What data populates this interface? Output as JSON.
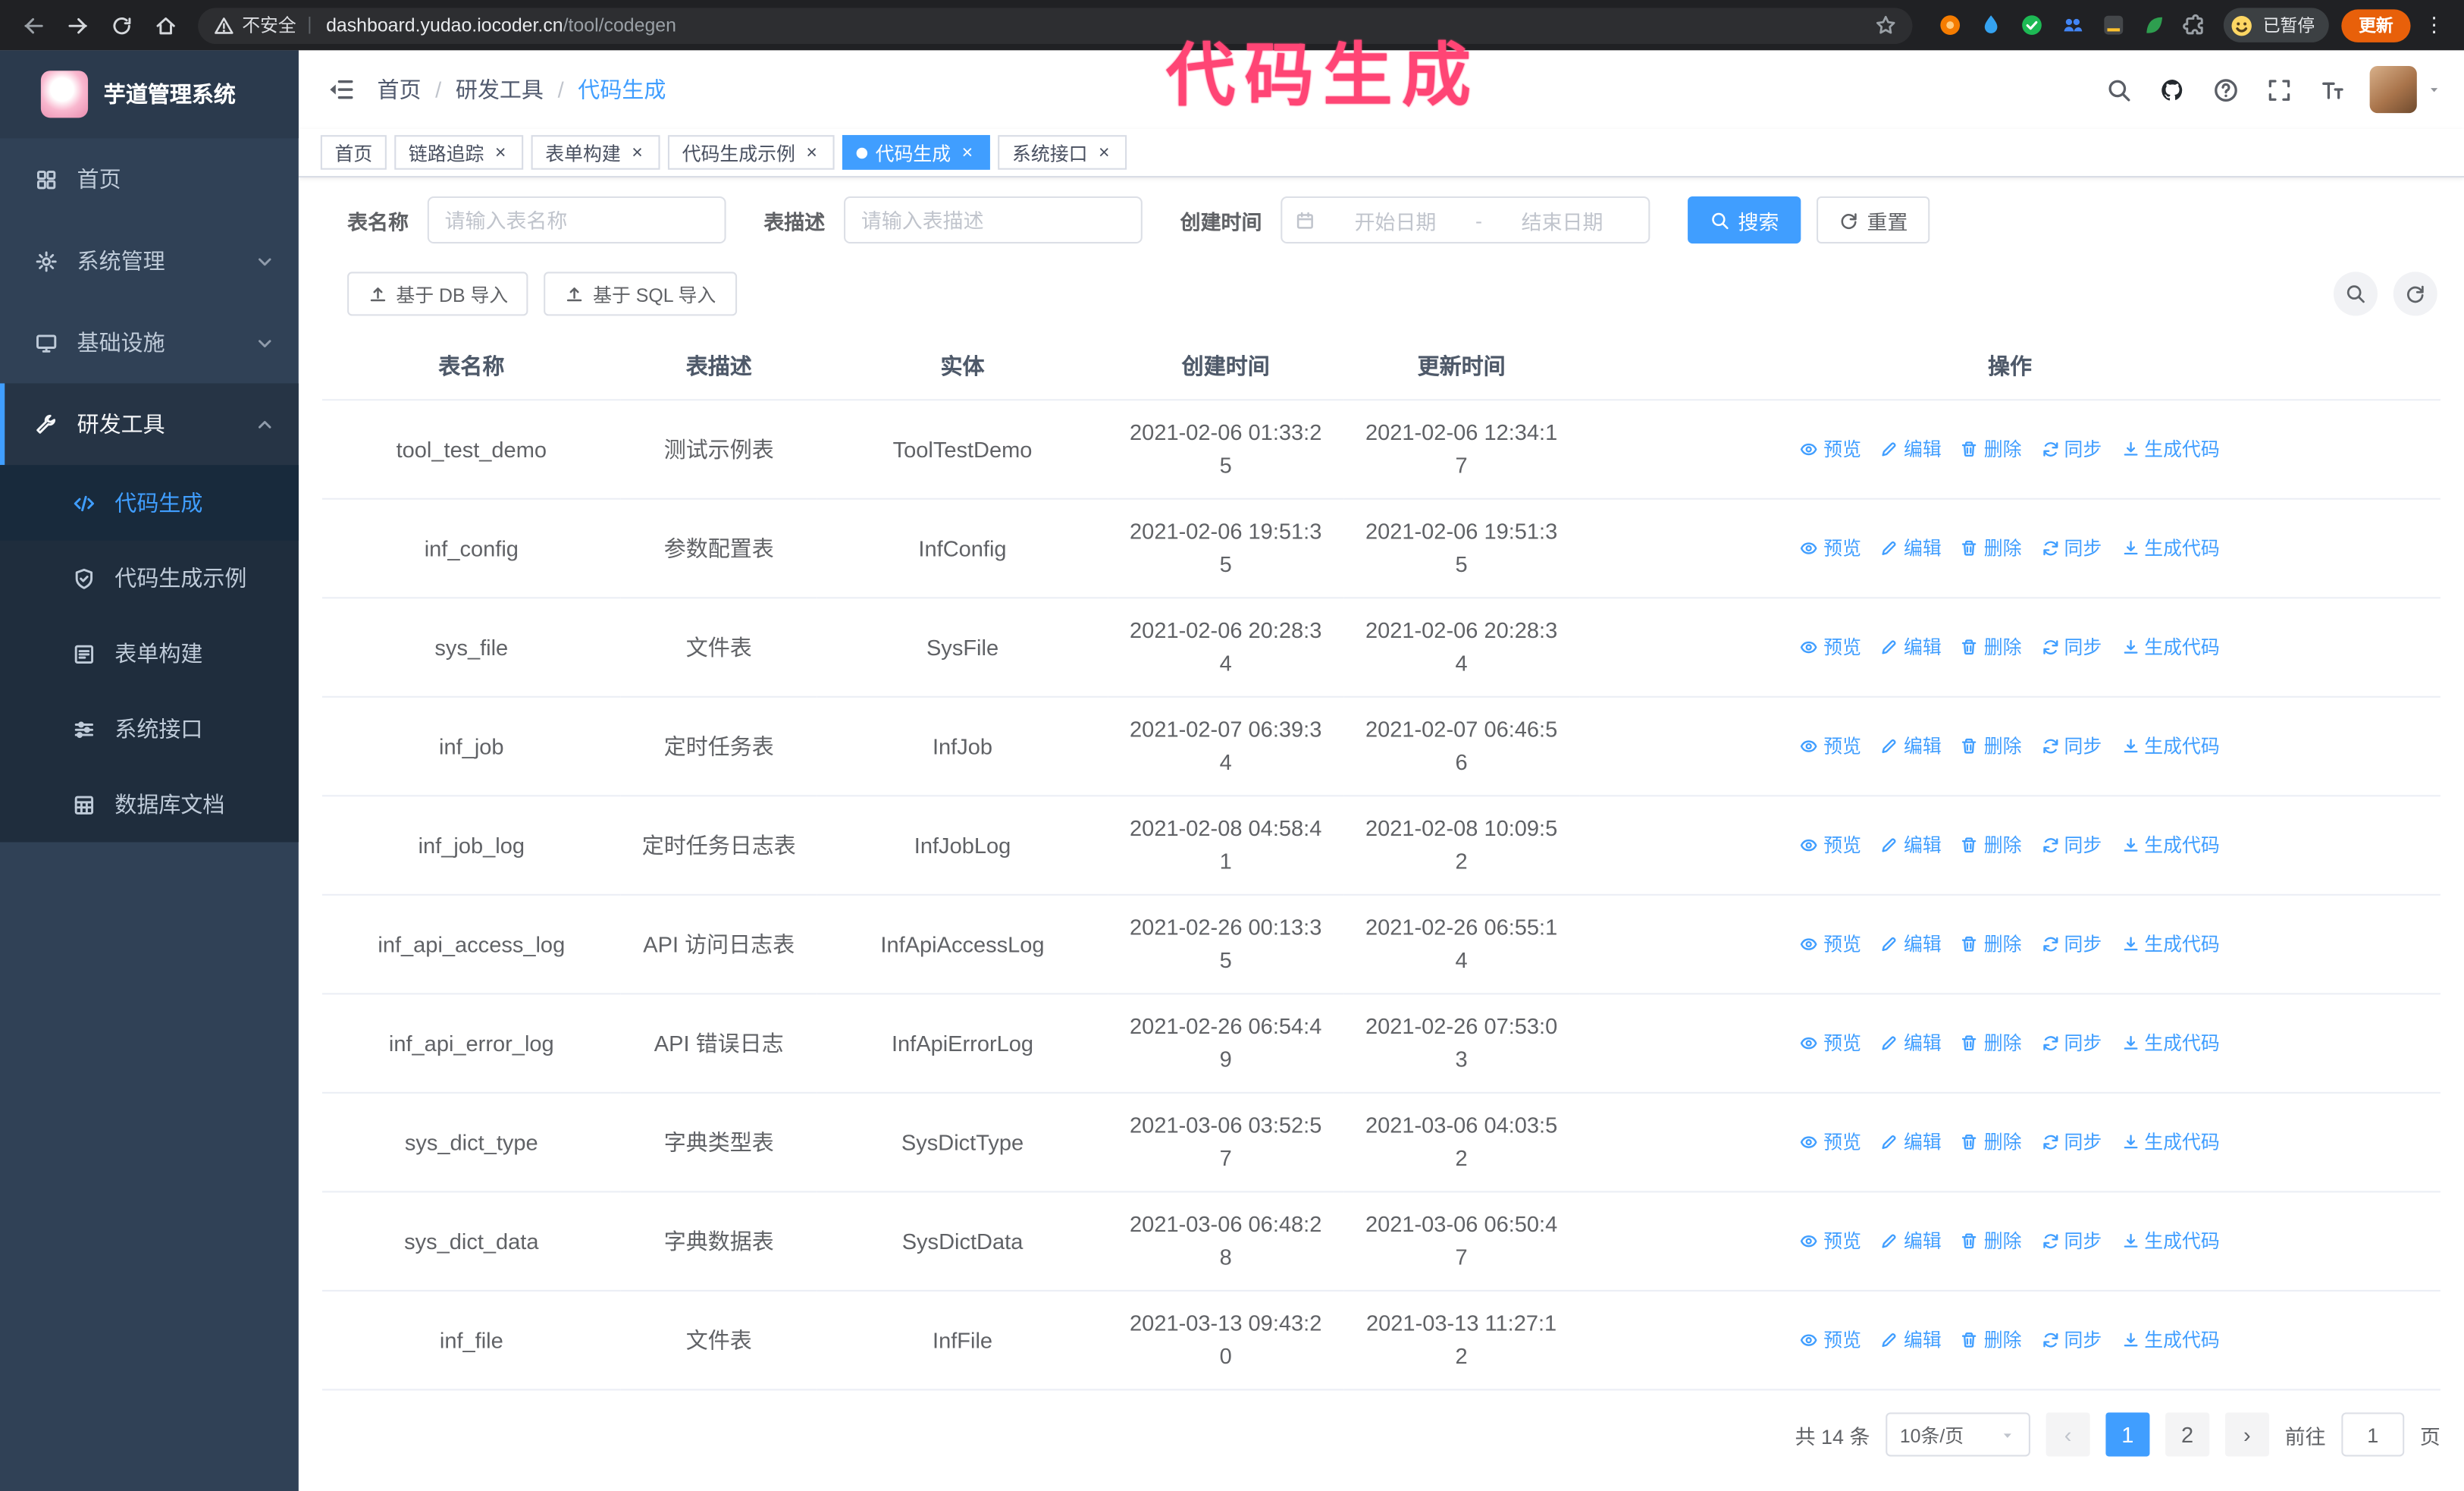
{
  "colors": {
    "accent": "#409eff",
    "annotation": "#ff4575",
    "sidebar_bg": "#304156",
    "submenu_bg": "#1f2d3d",
    "update_pill": "#e8600a"
  },
  "browser": {
    "security_text": "不安全",
    "url_host": "dashboard.yudao.iocoder.cn",
    "url_path": "/tool/codegen",
    "profile_badge": "已暂停",
    "update_label": "更新"
  },
  "annotation": {
    "text": "代码生成"
  },
  "sidebar": {
    "title": "芋道管理系统",
    "items": [
      {
        "label": "首页"
      },
      {
        "label": "系统管理"
      },
      {
        "label": "基础设施"
      },
      {
        "label": "研发工具"
      }
    ],
    "submenu": [
      {
        "label": "代码生成"
      },
      {
        "label": "代码生成示例"
      },
      {
        "label": "表单构建"
      },
      {
        "label": "系统接口"
      },
      {
        "label": "数据库文档"
      }
    ]
  },
  "breadcrumb": {
    "items": [
      "首页",
      "研发工具",
      "代码生成"
    ],
    "separator": "/"
  },
  "tabs": [
    {
      "label": "首页"
    },
    {
      "label": "链路追踪"
    },
    {
      "label": "表单构建"
    },
    {
      "label": "代码生成示例"
    },
    {
      "label": "代码生成"
    },
    {
      "label": "系统接口"
    }
  ],
  "filters": {
    "name_label": "表名称",
    "name_placeholder": "请输入表名称",
    "desc_label": "表描述",
    "desc_placeholder": "请输入表描述",
    "time_label": "创建时间",
    "start_placeholder": "开始日期",
    "range_separator": "-",
    "end_placeholder": "结束日期",
    "search_label": "搜索",
    "reset_label": "重置"
  },
  "toolbar": {
    "import_db_label": "基于 DB 导入",
    "import_sql_label": "基于 SQL 导入"
  },
  "table": {
    "columns": [
      "表名称",
      "表描述",
      "实体",
      "创建时间",
      "更新时间",
      "操作"
    ],
    "actions": [
      "预览",
      "编辑",
      "删除",
      "同步",
      "生成代码"
    ],
    "rows": [
      {
        "name": "tool_test_demo",
        "desc": "测试示例表",
        "entity": "ToolTestDemo",
        "created": "2021-02-06 01:33:25",
        "updated": "2021-02-06 12:34:17"
      },
      {
        "name": "inf_config",
        "desc": "参数配置表",
        "entity": "InfConfig",
        "created": "2021-02-06 19:51:35",
        "updated": "2021-02-06 19:51:35"
      },
      {
        "name": "sys_file",
        "desc": "文件表",
        "entity": "SysFile",
        "created": "2021-02-06 20:28:34",
        "updated": "2021-02-06 20:28:34"
      },
      {
        "name": "inf_job",
        "desc": "定时任务表",
        "entity": "InfJob",
        "created": "2021-02-07 06:39:34",
        "updated": "2021-02-07 06:46:56"
      },
      {
        "name": "inf_job_log",
        "desc": "定时任务日志表",
        "entity": "InfJobLog",
        "created": "2021-02-08 04:58:41",
        "updated": "2021-02-08 10:09:52"
      },
      {
        "name": "inf_api_access_log",
        "desc": "API 访问日志表",
        "entity": "InfApiAccessLog",
        "created": "2021-02-26 00:13:35",
        "updated": "2021-02-26 06:55:14"
      },
      {
        "name": "inf_api_error_log",
        "desc": "API 错误日志",
        "entity": "InfApiErrorLog",
        "created": "2021-02-26 06:54:49",
        "updated": "2021-02-26 07:53:03"
      },
      {
        "name": "sys_dict_type",
        "desc": "字典类型表",
        "entity": "SysDictType",
        "created": "2021-03-06 03:52:57",
        "updated": "2021-03-06 04:03:52"
      },
      {
        "name": "sys_dict_data",
        "desc": "字典数据表",
        "entity": "SysDictData",
        "created": "2021-03-06 06:48:28",
        "updated": "2021-03-06 06:50:47"
      },
      {
        "name": "inf_file",
        "desc": "文件表",
        "entity": "InfFile",
        "created": "2021-03-13 09:43:20",
        "updated": "2021-03-13 11:27:12"
      }
    ]
  },
  "pagination": {
    "total_text": "共 14 条",
    "page_size_text": "10条/页",
    "pages": [
      "1",
      "2"
    ],
    "goto_label": "前往",
    "goto_value": "1",
    "goto_unit": "页"
  },
  "glyphs": {
    "close": "×",
    "prev": "‹",
    "next": "›",
    "pipe": "|",
    "kebab": "⋮"
  }
}
